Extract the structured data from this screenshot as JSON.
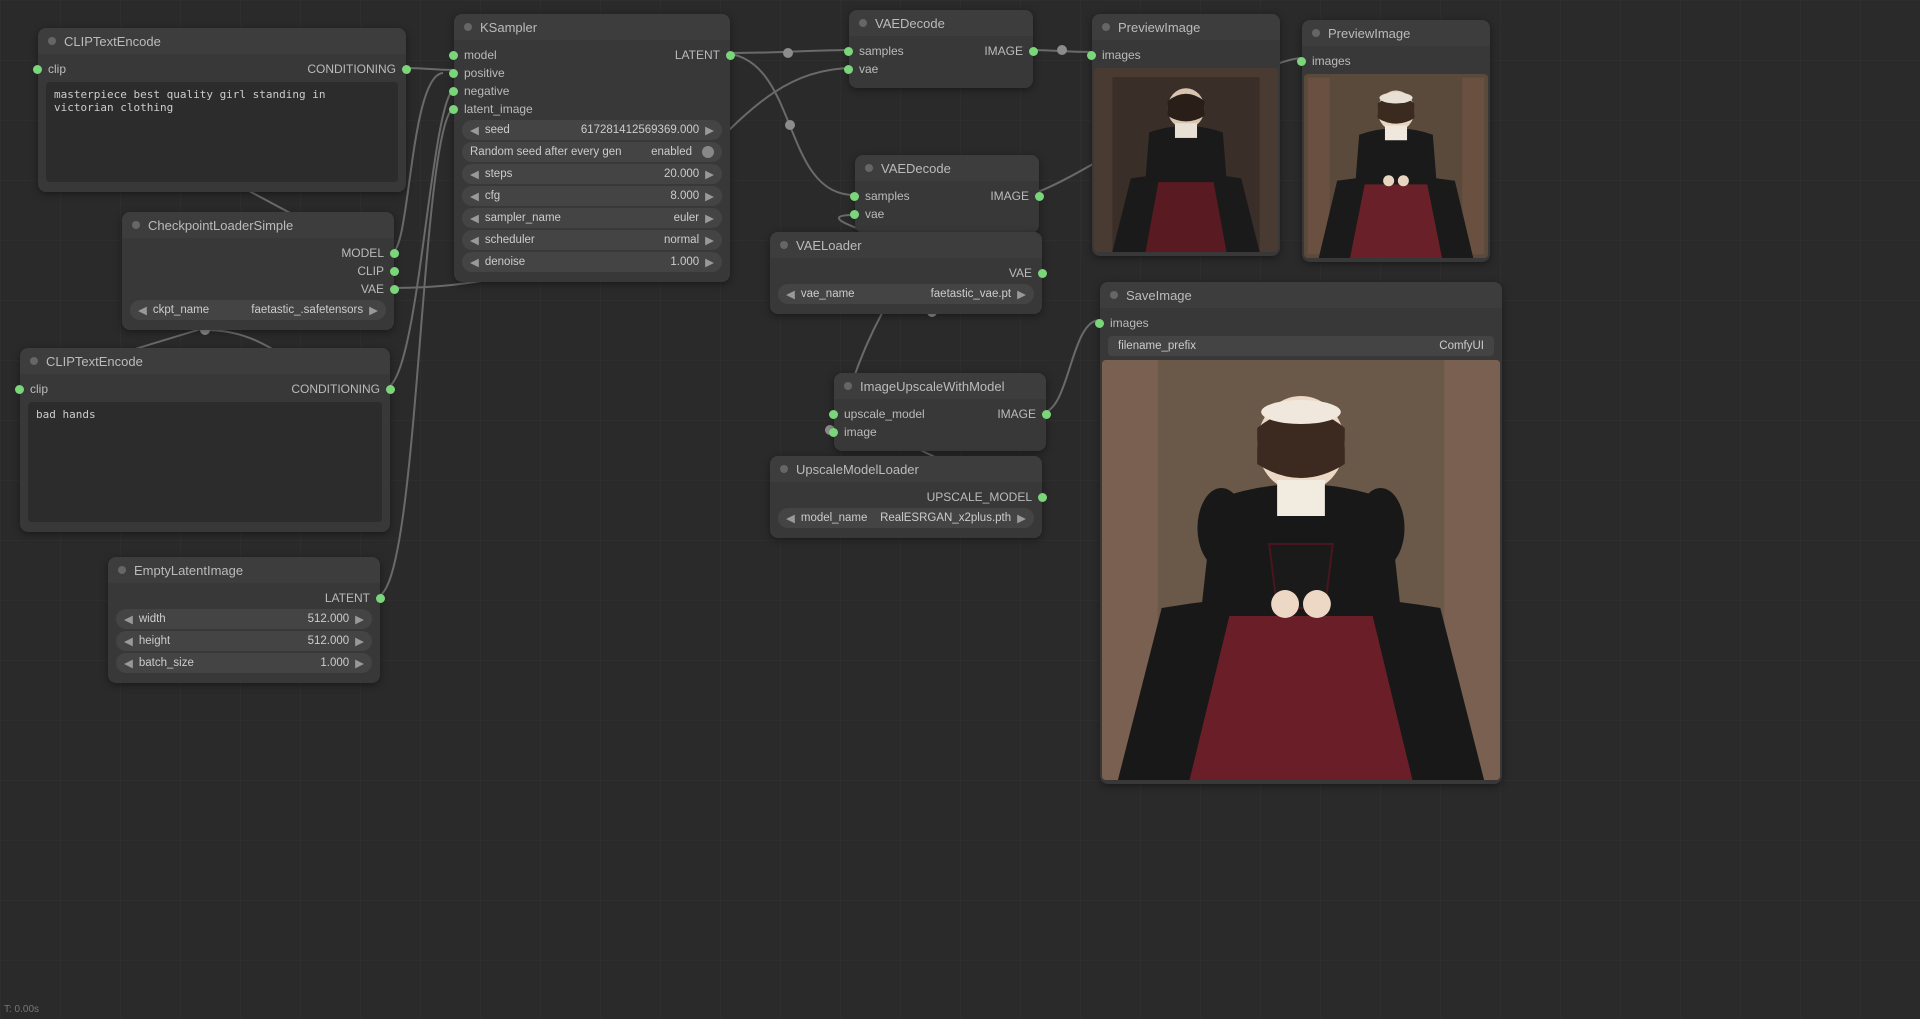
{
  "status": "T: 0.00s",
  "nodes": {
    "clip1": {
      "title": "CLIPTextEncode",
      "in_clip": "clip",
      "out_cond": "CONDITIONING",
      "text": "masterpiece best quality girl standing in victorian clothing"
    },
    "clip2": {
      "title": "CLIPTextEncode",
      "in_clip": "clip",
      "out_cond": "CONDITIONING",
      "text": "bad hands"
    },
    "ckpt": {
      "title": "CheckpointLoaderSimple",
      "out_model": "MODEL",
      "out_clip": "CLIP",
      "out_vae": "VAE",
      "ckpt_label": "ckpt_name",
      "ckpt_value": "faetastic_.safetensors"
    },
    "empty": {
      "title": "EmptyLatentImage",
      "out_latent": "LATENT",
      "width_label": "width",
      "width_value": "512.000",
      "height_label": "height",
      "height_value": "512.000",
      "batch_label": "batch_size",
      "batch_value": "1.000"
    },
    "ksampler": {
      "title": "KSampler",
      "in_model": "model",
      "in_positive": "positive",
      "in_negative": "negative",
      "in_latent": "latent_image",
      "out_latent": "LATENT",
      "seed_label": "seed",
      "seed_value": "617281412569369.000",
      "rand_label": "Random seed after every gen",
      "rand_value": "enabled",
      "steps_label": "steps",
      "steps_value": "20.000",
      "cfg_label": "cfg",
      "cfg_value": "8.000",
      "sampler_label": "sampler_name",
      "sampler_value": "euler",
      "scheduler_label": "scheduler",
      "scheduler_value": "normal",
      "denoise_label": "denoise",
      "denoise_value": "1.000"
    },
    "vaedec1": {
      "title": "VAEDecode",
      "in_samples": "samples",
      "in_vae": "vae",
      "out_image": "IMAGE"
    },
    "vaedec2": {
      "title": "VAEDecode",
      "in_samples": "samples",
      "in_vae": "vae",
      "out_image": "IMAGE"
    },
    "vaeloader": {
      "title": "VAELoader",
      "out_vae": "VAE",
      "vae_label": "vae_name",
      "vae_value": "faetastic_vae.pt"
    },
    "upscalemodel": {
      "title": "UpscaleModelLoader",
      "out": "UPSCALE_MODEL",
      "model_label": "model_name",
      "model_value": "RealESRGAN_x2plus.pth"
    },
    "imgupscale": {
      "title": "ImageUpscaleWithModel",
      "in_model": "upscale_model",
      "in_image": "image",
      "out_image": "IMAGE"
    },
    "preview1": {
      "title": "PreviewImage",
      "in_images": "images"
    },
    "preview2": {
      "title": "PreviewImage",
      "in_images": "images"
    },
    "save": {
      "title": "SaveImage",
      "in_images": "images",
      "prefix_label": "filename_prefix",
      "prefix_value": "ComfyUI"
    }
  }
}
